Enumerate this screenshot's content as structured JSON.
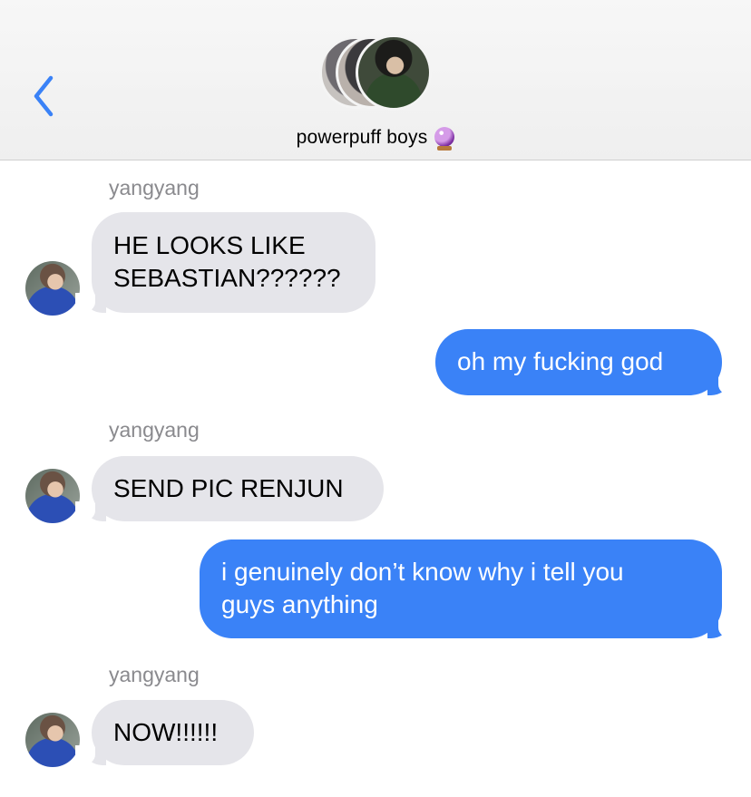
{
  "header": {
    "back_icon": "chevron-left-icon",
    "group_name": "powerpuff boys",
    "group_emoji": "crystal-ball-icon"
  },
  "colors": {
    "incoming_bubble": "#e5e5ea",
    "outgoing_bubble": "#3a82f7",
    "accent": "#3a82f7",
    "sender_name": "#8a8a8e"
  },
  "messages": [
    {
      "sender": "yangyang",
      "text_lines": [
        "HE LOOKS LIKE",
        "SEBASTIAN??????"
      ]
    },
    {
      "sender": "me",
      "text_lines": [
        "oh my fucking god"
      ]
    },
    {
      "sender": "yangyang",
      "text_lines": [
        "SEND PIC RENJUN"
      ]
    },
    {
      "sender": "me",
      "text_lines": [
        "i genuinely don’t know why i tell you",
        "guys anything"
      ]
    },
    {
      "sender": "yangyang",
      "text_lines": [
        "NOW!!!!!!"
      ]
    }
  ]
}
